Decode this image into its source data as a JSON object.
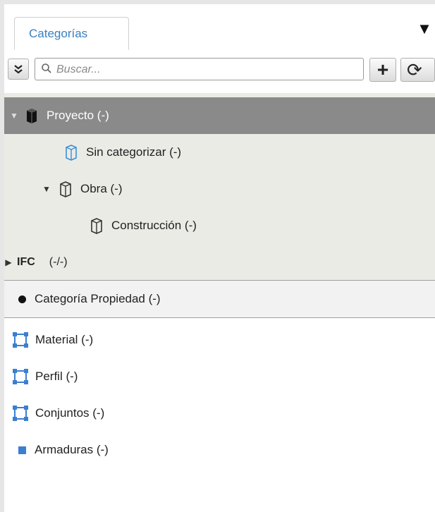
{
  "tabs": [
    {
      "label": "Categorías"
    }
  ],
  "tab_menu_glyph": "▼",
  "search": {
    "placeholder": "Buscar..."
  },
  "toolbar": {
    "add_glyph": "+",
    "refresh_glyph": "⟳"
  },
  "tree": {
    "root": {
      "label": "Proyecto (-)",
      "expanded": true,
      "selected": true
    },
    "items": [
      {
        "label": "Sin categorizar (-)",
        "icon": "box-icon",
        "color": "#3b8fd6"
      },
      {
        "label": "Obra (-)",
        "icon": "box-icon",
        "expanded": true
      },
      {
        "label": "Construcción (-)",
        "icon": "box-icon"
      }
    ],
    "ifc": {
      "label": "IFC",
      "count": "(-/-)",
      "expanded": false
    }
  },
  "properties": {
    "header": "Categoría Propiedad (-)",
    "items": [
      {
        "label": "Material (-)",
        "icon": "node-square-icon"
      },
      {
        "label": "Perfil (-)",
        "icon": "node-square-icon"
      },
      {
        "label": "Conjuntos (-)",
        "icon": "node-square-icon"
      },
      {
        "label": "Armaduras (-)",
        "icon": "small-square-icon"
      }
    ]
  },
  "colors": {
    "accent": "#3a7fc1",
    "selected_row": "#8a8a8a",
    "tree_bg": "#ebebe5",
    "node_icon": "#3b7fd0"
  }
}
